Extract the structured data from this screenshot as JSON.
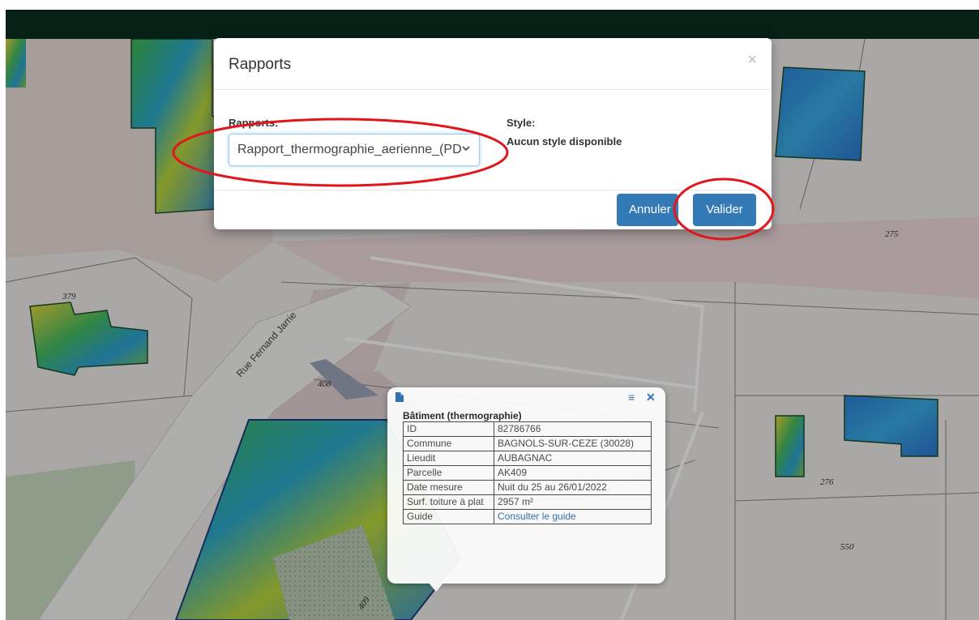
{
  "map": {
    "street_name": "Rue Fernand Jarrie",
    "parcel_labels": [
      "379",
      "408",
      "275",
      "276",
      "550",
      "409"
    ]
  },
  "modal": {
    "title": "Rapports",
    "close_symbol": "×",
    "reports_label": "Rapports:",
    "report_selected": "Rapport_thermographie_aerienne_(PD",
    "style_label": "Style:",
    "style_value": "Aucun style disponible",
    "cancel_label": "Annuler",
    "validate_label": "Valider"
  },
  "popup": {
    "title": "Bâtiment (thermographie)",
    "rows": [
      {
        "key": "ID",
        "value": "82786766"
      },
      {
        "key": "Commune",
        "value": "BAGNOLS-SUR-CEZE (30028)"
      },
      {
        "key": "Lieudit",
        "value": "AUBAGNAC"
      },
      {
        "key": "Parcelle",
        "value": "AK409"
      },
      {
        "key": "Date mesure",
        "value": "Nuit du 25 au 26/01/2022"
      },
      {
        "key": "Surf. toiture à plat",
        "value": "2957 m²"
      },
      {
        "key": "Guide",
        "value": "Consulter le guide"
      }
    ]
  },
  "icons": {
    "document": "document-icon",
    "menu": "menu-icon",
    "close": "close-icon",
    "chevron": "chevron-down-icon"
  },
  "colors": {
    "topbar": "#062016",
    "primary_button": "#337ab7",
    "annotation_red": "#e0161c",
    "link": "#2a6fb0"
  }
}
